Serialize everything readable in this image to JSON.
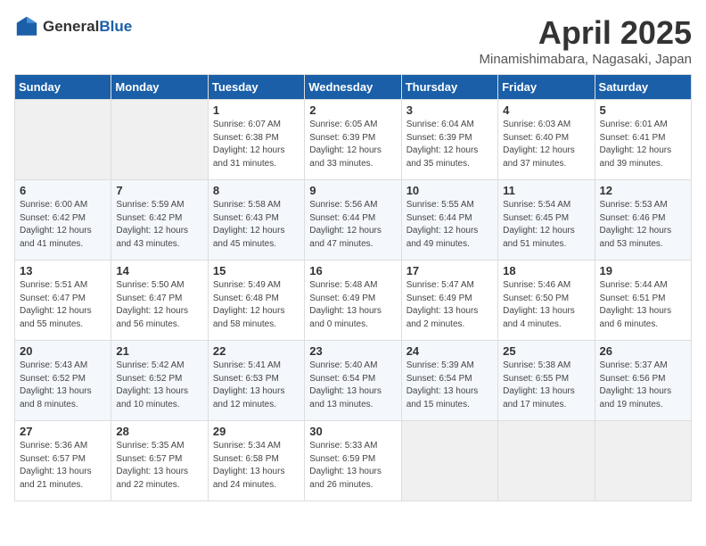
{
  "header": {
    "logo_general": "General",
    "logo_blue": "Blue",
    "month_title": "April 2025",
    "location": "Minamishimabara, Nagasaki, Japan"
  },
  "days_of_week": [
    "Sunday",
    "Monday",
    "Tuesday",
    "Wednesday",
    "Thursday",
    "Friday",
    "Saturday"
  ],
  "weeks": [
    [
      {
        "day": "",
        "empty": true
      },
      {
        "day": "",
        "empty": true
      },
      {
        "day": "1",
        "sunrise": "Sunrise: 6:07 AM",
        "sunset": "Sunset: 6:38 PM",
        "daylight": "Daylight: 12 hours and 31 minutes."
      },
      {
        "day": "2",
        "sunrise": "Sunrise: 6:05 AM",
        "sunset": "Sunset: 6:39 PM",
        "daylight": "Daylight: 12 hours and 33 minutes."
      },
      {
        "day": "3",
        "sunrise": "Sunrise: 6:04 AM",
        "sunset": "Sunset: 6:39 PM",
        "daylight": "Daylight: 12 hours and 35 minutes."
      },
      {
        "day": "4",
        "sunrise": "Sunrise: 6:03 AM",
        "sunset": "Sunset: 6:40 PM",
        "daylight": "Daylight: 12 hours and 37 minutes."
      },
      {
        "day": "5",
        "sunrise": "Sunrise: 6:01 AM",
        "sunset": "Sunset: 6:41 PM",
        "daylight": "Daylight: 12 hours and 39 minutes."
      }
    ],
    [
      {
        "day": "6",
        "sunrise": "Sunrise: 6:00 AM",
        "sunset": "Sunset: 6:42 PM",
        "daylight": "Daylight: 12 hours and 41 minutes."
      },
      {
        "day": "7",
        "sunrise": "Sunrise: 5:59 AM",
        "sunset": "Sunset: 6:42 PM",
        "daylight": "Daylight: 12 hours and 43 minutes."
      },
      {
        "day": "8",
        "sunrise": "Sunrise: 5:58 AM",
        "sunset": "Sunset: 6:43 PM",
        "daylight": "Daylight: 12 hours and 45 minutes."
      },
      {
        "day": "9",
        "sunrise": "Sunrise: 5:56 AM",
        "sunset": "Sunset: 6:44 PM",
        "daylight": "Daylight: 12 hours and 47 minutes."
      },
      {
        "day": "10",
        "sunrise": "Sunrise: 5:55 AM",
        "sunset": "Sunset: 6:44 PM",
        "daylight": "Daylight: 12 hours and 49 minutes."
      },
      {
        "day": "11",
        "sunrise": "Sunrise: 5:54 AM",
        "sunset": "Sunset: 6:45 PM",
        "daylight": "Daylight: 12 hours and 51 minutes."
      },
      {
        "day": "12",
        "sunrise": "Sunrise: 5:53 AM",
        "sunset": "Sunset: 6:46 PM",
        "daylight": "Daylight: 12 hours and 53 minutes."
      }
    ],
    [
      {
        "day": "13",
        "sunrise": "Sunrise: 5:51 AM",
        "sunset": "Sunset: 6:47 PM",
        "daylight": "Daylight: 12 hours and 55 minutes."
      },
      {
        "day": "14",
        "sunrise": "Sunrise: 5:50 AM",
        "sunset": "Sunset: 6:47 PM",
        "daylight": "Daylight: 12 hours and 56 minutes."
      },
      {
        "day": "15",
        "sunrise": "Sunrise: 5:49 AM",
        "sunset": "Sunset: 6:48 PM",
        "daylight": "Daylight: 12 hours and 58 minutes."
      },
      {
        "day": "16",
        "sunrise": "Sunrise: 5:48 AM",
        "sunset": "Sunset: 6:49 PM",
        "daylight": "Daylight: 13 hours and 0 minutes."
      },
      {
        "day": "17",
        "sunrise": "Sunrise: 5:47 AM",
        "sunset": "Sunset: 6:49 PM",
        "daylight": "Daylight: 13 hours and 2 minutes."
      },
      {
        "day": "18",
        "sunrise": "Sunrise: 5:46 AM",
        "sunset": "Sunset: 6:50 PM",
        "daylight": "Daylight: 13 hours and 4 minutes."
      },
      {
        "day": "19",
        "sunrise": "Sunrise: 5:44 AM",
        "sunset": "Sunset: 6:51 PM",
        "daylight": "Daylight: 13 hours and 6 minutes."
      }
    ],
    [
      {
        "day": "20",
        "sunrise": "Sunrise: 5:43 AM",
        "sunset": "Sunset: 6:52 PM",
        "daylight": "Daylight: 13 hours and 8 minutes."
      },
      {
        "day": "21",
        "sunrise": "Sunrise: 5:42 AM",
        "sunset": "Sunset: 6:52 PM",
        "daylight": "Daylight: 13 hours and 10 minutes."
      },
      {
        "day": "22",
        "sunrise": "Sunrise: 5:41 AM",
        "sunset": "Sunset: 6:53 PM",
        "daylight": "Daylight: 13 hours and 12 minutes."
      },
      {
        "day": "23",
        "sunrise": "Sunrise: 5:40 AM",
        "sunset": "Sunset: 6:54 PM",
        "daylight": "Daylight: 13 hours and 13 minutes."
      },
      {
        "day": "24",
        "sunrise": "Sunrise: 5:39 AM",
        "sunset": "Sunset: 6:54 PM",
        "daylight": "Daylight: 13 hours and 15 minutes."
      },
      {
        "day": "25",
        "sunrise": "Sunrise: 5:38 AM",
        "sunset": "Sunset: 6:55 PM",
        "daylight": "Daylight: 13 hours and 17 minutes."
      },
      {
        "day": "26",
        "sunrise": "Sunrise: 5:37 AM",
        "sunset": "Sunset: 6:56 PM",
        "daylight": "Daylight: 13 hours and 19 minutes."
      }
    ],
    [
      {
        "day": "27",
        "sunrise": "Sunrise: 5:36 AM",
        "sunset": "Sunset: 6:57 PM",
        "daylight": "Daylight: 13 hours and 21 minutes."
      },
      {
        "day": "28",
        "sunrise": "Sunrise: 5:35 AM",
        "sunset": "Sunset: 6:57 PM",
        "daylight": "Daylight: 13 hours and 22 minutes."
      },
      {
        "day": "29",
        "sunrise": "Sunrise: 5:34 AM",
        "sunset": "Sunset: 6:58 PM",
        "daylight": "Daylight: 13 hours and 24 minutes."
      },
      {
        "day": "30",
        "sunrise": "Sunrise: 5:33 AM",
        "sunset": "Sunset: 6:59 PM",
        "daylight": "Daylight: 13 hours and 26 minutes."
      },
      {
        "day": "",
        "empty": true
      },
      {
        "day": "",
        "empty": true
      },
      {
        "day": "",
        "empty": true
      }
    ]
  ]
}
